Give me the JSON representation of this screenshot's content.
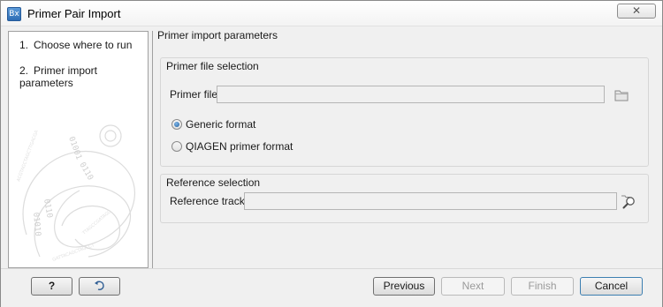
{
  "window": {
    "title": "Primer Pair Import",
    "app_icon_text": "Bx",
    "close_glyph": "✕"
  },
  "steps": [
    {
      "number": "1.",
      "label": "Choose where to run"
    },
    {
      "number": "2.",
      "label": "Primer import parameters"
    }
  ],
  "content": {
    "heading": "Primer import parameters",
    "primer_file_group": {
      "title": "Primer file selection",
      "field_label": "Primer file",
      "field_value": "",
      "options": [
        {
          "label": "Generic format",
          "checked": true
        },
        {
          "label": "QIAGEN primer format",
          "checked": false
        }
      ]
    },
    "reference_group": {
      "title": "Reference selection",
      "field_label": "Reference track",
      "field_value": ""
    }
  },
  "buttons": {
    "help": "?",
    "reset_icon": "reset-arrow-icon",
    "previous": "Previous",
    "next": "Next",
    "finish": "Finish",
    "cancel": "Cancel"
  },
  "colors": {
    "accent": "#3c7fb1",
    "window_bg": "#f0f0f0"
  }
}
